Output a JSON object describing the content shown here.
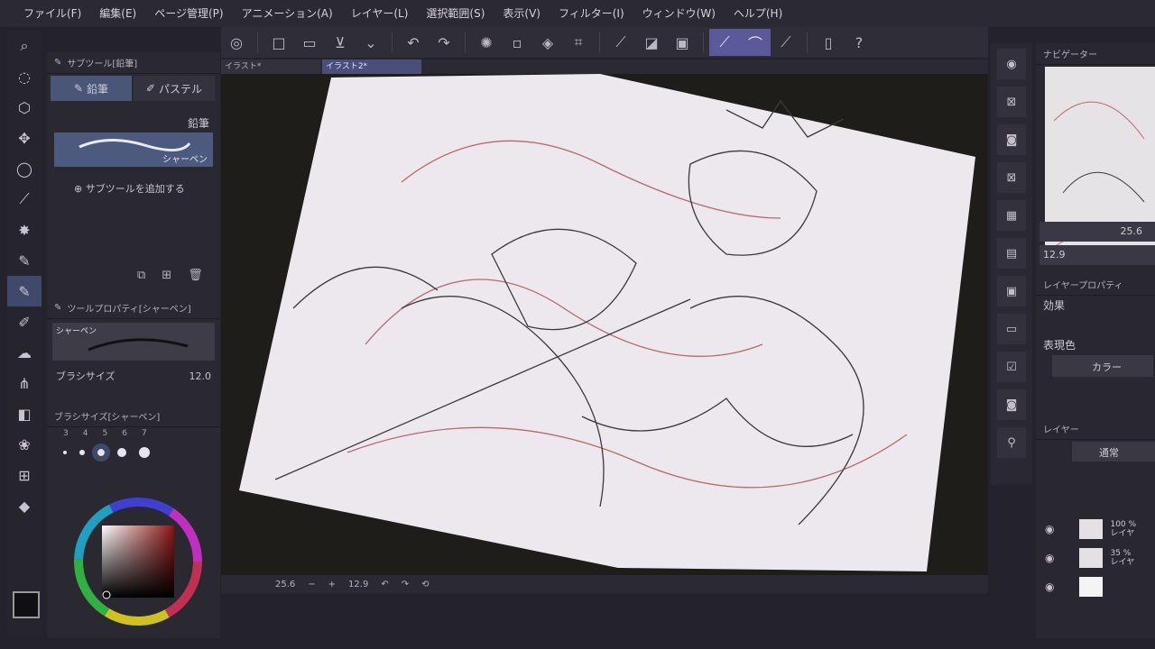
{
  "menu": [
    "ファイル(F)",
    "編集(E)",
    "ページ管理(P)",
    "アニメーション(A)",
    "レイヤー(L)",
    "選択範囲(S)",
    "表示(V)",
    "フィルター(I)",
    "ウィンドウ(W)",
    "ヘルプ(H)"
  ],
  "doc_tabs": [
    "イラスト*",
    "イラスト2*"
  ],
  "subtool_panel": {
    "title": "サブツール[鉛筆]",
    "tabs": [
      "鉛筆",
      "パステル"
    ],
    "group_label": "鉛筆",
    "selected_brush": "シャーペン",
    "add_label": "サブツールを追加する"
  },
  "tool_property": {
    "title": "ツールプロパティ[シャーペン]",
    "preview_name": "シャーペン",
    "size_label": "ブラシサイズ",
    "size_value": "12.0"
  },
  "brush_size_panel": {
    "title": "ブラシサイズ[シャーペン]",
    "sizes": [
      "3",
      "4",
      "5",
      "6",
      "7"
    ]
  },
  "status": {
    "zoom": "25.6",
    "rotation": "12.9"
  },
  "navigator": {
    "title": "ナビゲーター",
    "zoom": "25.6",
    "rotation": "12.9"
  },
  "layer_property": {
    "title": "レイヤープロパティ",
    "effect_label": "効果",
    "color_label": "表現色",
    "color_value": "カラー"
  },
  "layers": {
    "title": "レイヤー",
    "blend_mode": "通常",
    "items": [
      {
        "opacity": "100 %",
        "name": "レイヤ"
      },
      {
        "opacity": "35 %",
        "name": "レイヤ"
      },
      {
        "opacity": "",
        "name": ""
      }
    ]
  },
  "colors": {
    "main": "#101014",
    "sub": "#1c2f45",
    "hue": "#8c1414"
  }
}
